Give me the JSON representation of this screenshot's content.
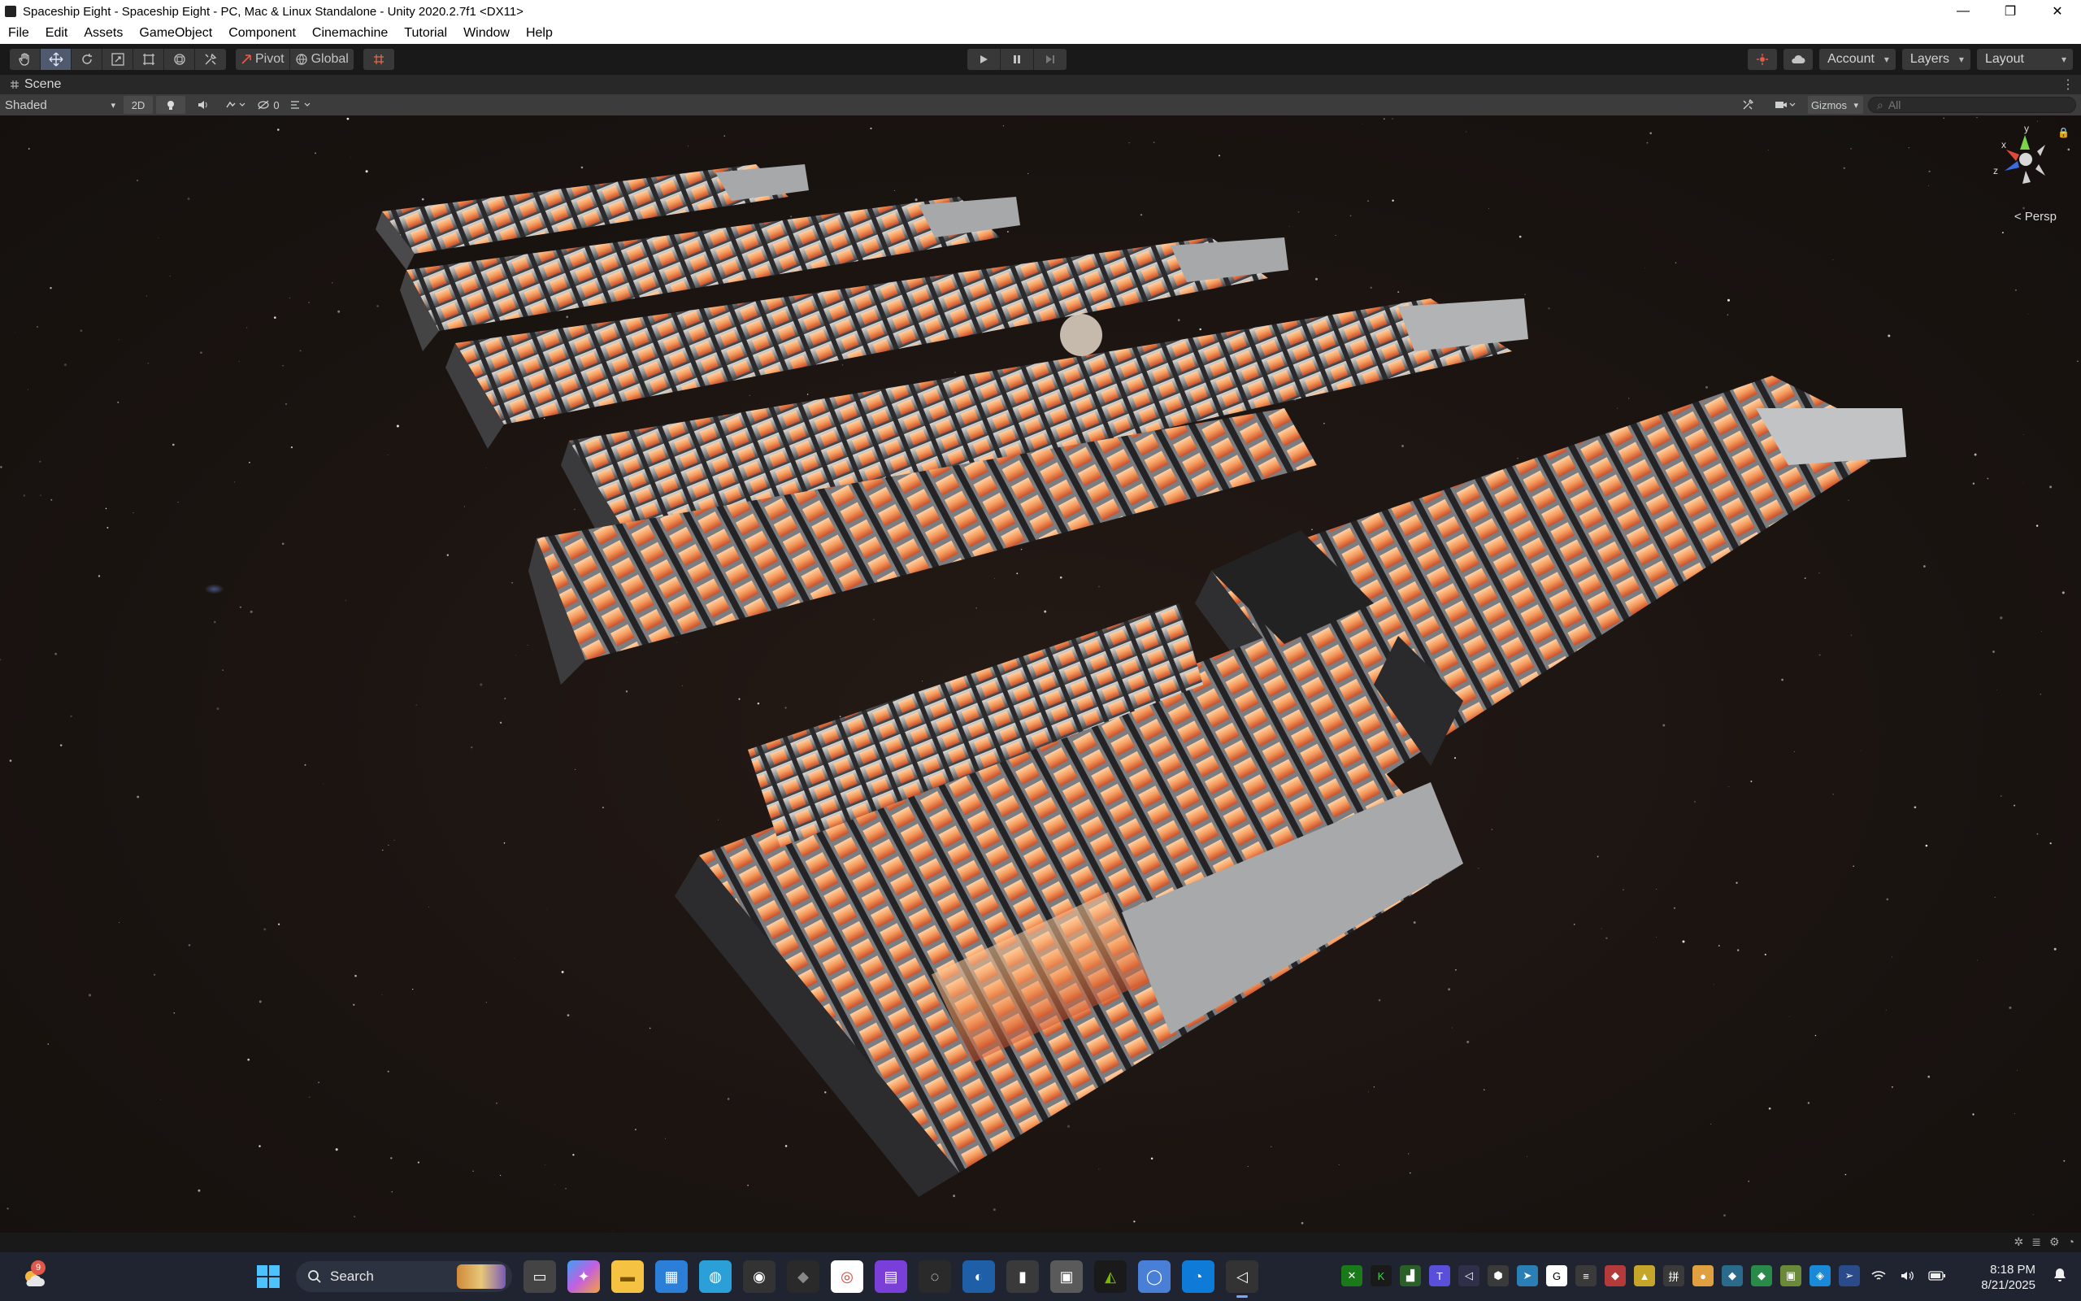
{
  "window": {
    "title": "Spaceship Eight - Spaceship Eight - PC, Mac & Linux Standalone - Unity 2020.2.7f1 <DX11>",
    "controls": {
      "minimize": "—",
      "maximize": "❐",
      "close": "✕"
    }
  },
  "menu": [
    "File",
    "Edit",
    "Assets",
    "GameObject",
    "Component",
    "Cinemachine",
    "Tutorial",
    "Window",
    "Help"
  ],
  "toolbar": {
    "pivot_label": "Pivot",
    "global_label": "Global",
    "account_label": "Account",
    "layers_label": "Layers",
    "layout_label": "Layout"
  },
  "scene": {
    "tab_label": "Scene",
    "shading_mode": "Shaded",
    "two_d_label": "2D",
    "hidden_count": "0",
    "gizmos_label": "Gizmos",
    "search_placeholder": "All",
    "axis_labels": {
      "y": "y",
      "x": "x",
      "z": "z"
    },
    "projection_label": "< Persp"
  },
  "taskbar": {
    "weather_badge": "9",
    "search_label": "Search",
    "time": "8:18 PM",
    "date": "8/21/2025"
  },
  "colors": {
    "editor_dark": "#191919",
    "panel": "#282828",
    "accent_orange": "#f08a4b",
    "hull_grey": "#8a8f94",
    "taskbar": "#1f2430"
  }
}
